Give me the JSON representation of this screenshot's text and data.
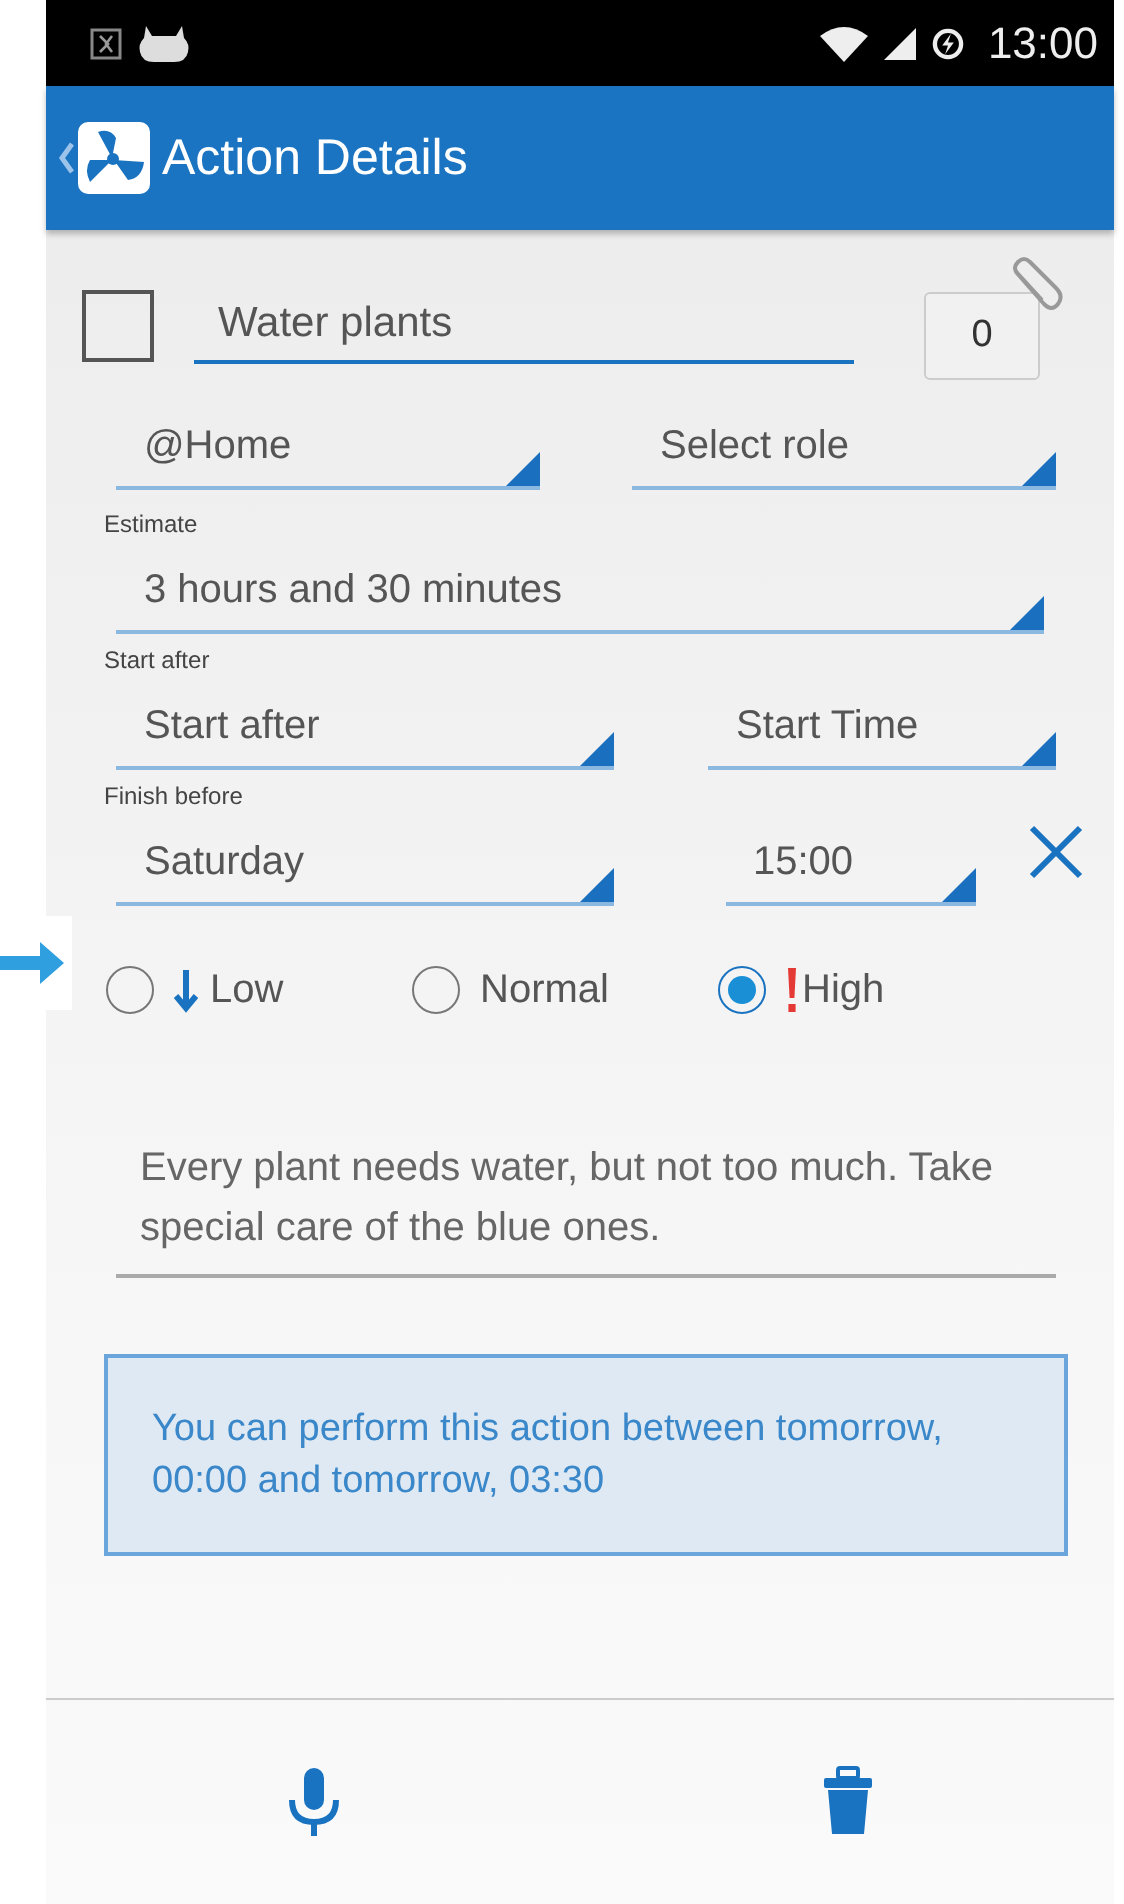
{
  "status_bar": {
    "time": "13:00"
  },
  "app_bar": {
    "title": "Action Details"
  },
  "task": {
    "checked": false,
    "title": "Water plants",
    "attachments": "0"
  },
  "context_row": [
    {
      "text": "@Home"
    },
    {
      "text": "Select role"
    }
  ],
  "estimate": {
    "label": "Estimate",
    "value": "3 hours and 30 minutes"
  },
  "start_after": {
    "label": "Start after",
    "date": "Start after",
    "time": "Start Time"
  },
  "finish_before": {
    "label": "Finish before",
    "date": "Saturday",
    "time": "15:00",
    "clearable": true
  },
  "priority": [
    {
      "kind": "low",
      "label": "Low",
      "selected": false
    },
    {
      "kind": "normal",
      "label": "Normal",
      "selected": false
    },
    {
      "kind": "high",
      "label": "High",
      "selected": true
    }
  ],
  "notes": "Every plant needs water, but not too much.  Take special care of the blue ones.",
  "info": "You can perform this action between tomorrow, 00:00 and tomorrow, 03:30",
  "bottom_actions": [
    {
      "kind": "voice"
    },
    {
      "kind": "delete"
    }
  ]
}
